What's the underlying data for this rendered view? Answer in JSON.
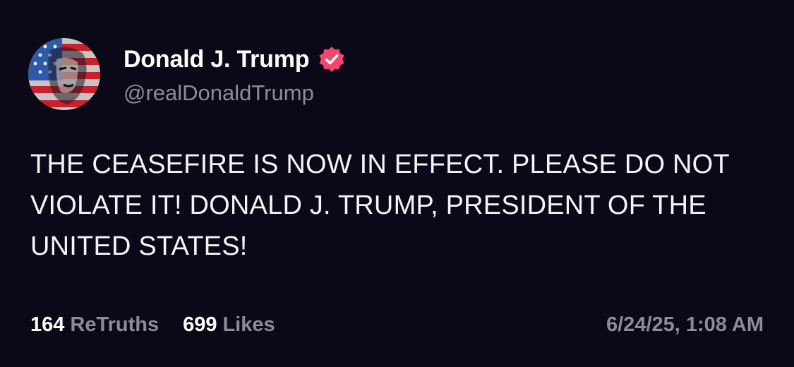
{
  "post": {
    "author": {
      "display_name": "Donald J. Trump",
      "handle": "@realDonaldTrump",
      "verified": true,
      "avatar_icon": "flag-portrait-avatar",
      "badge_icon": "verified-badge-icon",
      "badge_color": "#f0466f"
    },
    "text": "THE CEASEFIRE IS NOW IN EFFECT. PLEASE DO NOT VIOLATE IT! DONALD J. TRUMP, PRESIDENT OF THE UNITED STATES!",
    "stats": {
      "retruths_count": "164",
      "retruths_label": "ReTruths",
      "likes_count": "699",
      "likes_label": "Likes"
    },
    "timestamp": "6/24/25, 1:08 AM"
  },
  "colors": {
    "background": "#0b0818",
    "primary_text": "#ffffff",
    "secondary_text": "#8d8a99",
    "badge": "#f0466f"
  }
}
